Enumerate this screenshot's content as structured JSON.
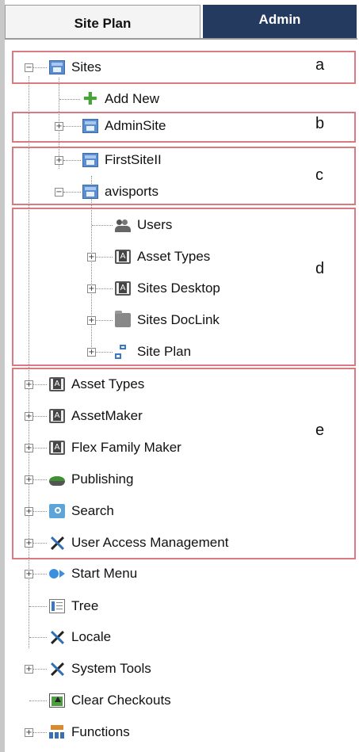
{
  "tabs": [
    {
      "label": "Site Plan",
      "active": true
    },
    {
      "label": "Admin",
      "active": false
    }
  ],
  "tree": {
    "sites": "Sites",
    "add_new": "Add New",
    "admin_site": "AdminSite",
    "first_site": "FirstSiteII",
    "avisports": "avisports",
    "users": "Users",
    "asset_types_sub": "Asset Types",
    "sites_desktop": "Sites Desktop",
    "sites_doclink": "Sites DocLink",
    "site_plan": "Site Plan",
    "asset_types": "Asset Types",
    "asset_maker": "AssetMaker",
    "flex_family_maker": "Flex Family Maker",
    "publishing": "Publishing",
    "search": "Search",
    "user_access_management": "User Access Management",
    "start_menu": "Start Menu",
    "tree": "Tree",
    "locale": "Locale",
    "system_tools": "System Tools",
    "clear_checkouts": "Clear Checkouts",
    "functions": "Functions"
  },
  "callouts": {
    "a": "a",
    "b": "b",
    "c": "c",
    "d": "d",
    "e": "e"
  },
  "icons": {
    "sites": "sites-icon",
    "add": "add-icon",
    "users": "users-icon",
    "asset_type": "asset-type-icon",
    "folder": "folder-icon",
    "site_plan": "site-plan-icon",
    "publishing": "publishing-icon",
    "search": "search-icon",
    "tools": "tools-icon",
    "start": "start-menu-icon",
    "tree": "tree-icon",
    "clear": "clear-checkouts-icon",
    "functions": "functions-icon"
  },
  "colors": {
    "admin_tab": "#243a5e",
    "callout_border": "#d97a80"
  }
}
